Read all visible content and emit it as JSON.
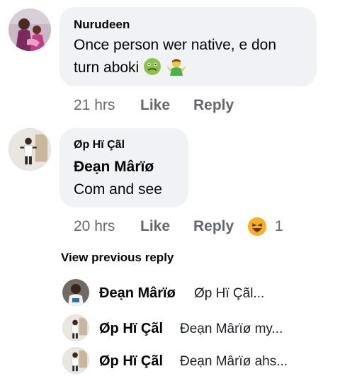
{
  "comments": [
    {
      "author": "Nurudeen",
      "text_line1": "Once person wer native, e don",
      "text_line2": "turn aboki",
      "emojis": [
        "nauseated-face-emoji",
        "shrug-emoji"
      ],
      "time": "21 hrs",
      "like_label": "Like",
      "reply_label": "Reply"
    },
    {
      "author": "Øp Hï Çãl",
      "mention": "Đeạn Mârïø",
      "text": "Com and see",
      "time": "20 hrs",
      "like_label": "Like",
      "reply_label": "Reply",
      "reaction": "laughing-emoji",
      "reaction_count": "1"
    }
  ],
  "view_previous_reply": "View previous reply",
  "replies": [
    {
      "author": "Đeạn Mârïø",
      "preview": "Øp Hï Çãl..."
    },
    {
      "author": "Øp Hï Çãl",
      "preview": "Đeạn Mârïø my..."
    },
    {
      "author": "Øp Hï Çãl",
      "preview": "Đeạn Mârïø ahs..."
    }
  ],
  "colors": {
    "bubble": "#f0f2f5",
    "meta_text": "#65676b",
    "primary_text": "#050505",
    "haha_yellow": "#f7b125"
  }
}
